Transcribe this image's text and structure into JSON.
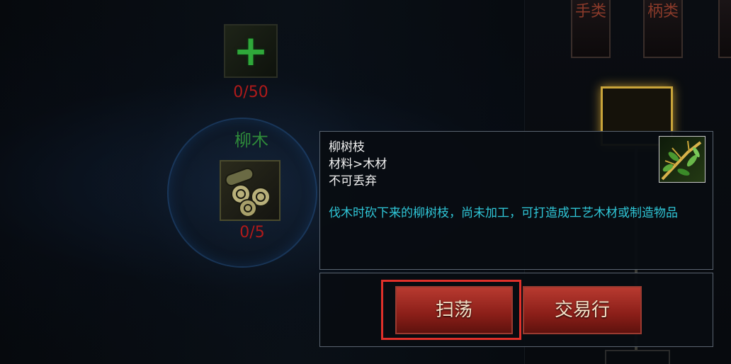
{
  "left_panel": {
    "add_slot_count": "0/50",
    "material_name": "柳木",
    "material_count": "0/5"
  },
  "right_tabs": [
    "手类",
    "柄类"
  ],
  "tooltip": {
    "item_name": "柳树枝",
    "category": "材料>木材",
    "flag": "不可丢弃",
    "description": "伐木时砍下来的柳树枝，尚未加工，可打造成工艺木材或制造物品",
    "icon": "willow-branch-icon"
  },
  "actions": {
    "sweep_label": "扫荡",
    "trade_label": "交易行"
  },
  "colors": {
    "count_red": "#b01a1a",
    "material_green": "#2e8a3a",
    "desc_cyan": "#2fc7d8",
    "button_red": "#8a1e18",
    "highlight": "#e0302a"
  }
}
